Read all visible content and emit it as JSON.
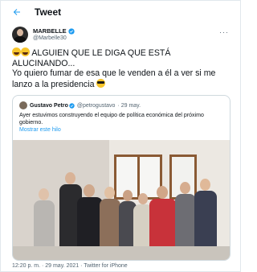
{
  "header": {
    "title": "Tweet"
  },
  "author": {
    "name": "MARBELLE",
    "handle": "@Marbelle30"
  },
  "tweet": {
    "line1": "ALGUIEN QUE LE DIGA QUE ESTÁ ALUCINANDO...",
    "line2": "Yo quiero fumar de esa que le venden a él a ver si me lanzo a la presidencia"
  },
  "quote": {
    "name": "Gustavo Petro",
    "handle": "@petrogustavo",
    "date": "· 29 may.",
    "text": "Ayer estuvimos construyendo el equipo de política económica del próximo gobierno.",
    "thread_link": "Mostrar este hilo"
  },
  "footer": {
    "meta": "12:20 p. m. · 29 may. 2021 · Twitter for iPhone"
  },
  "colors": {
    "accent": "#1d9bf0",
    "verified": "#1d9bf0"
  },
  "icons": {
    "back": "arrow-left-icon",
    "verified": "verified-badge-icon",
    "more": "more-options-icon"
  }
}
